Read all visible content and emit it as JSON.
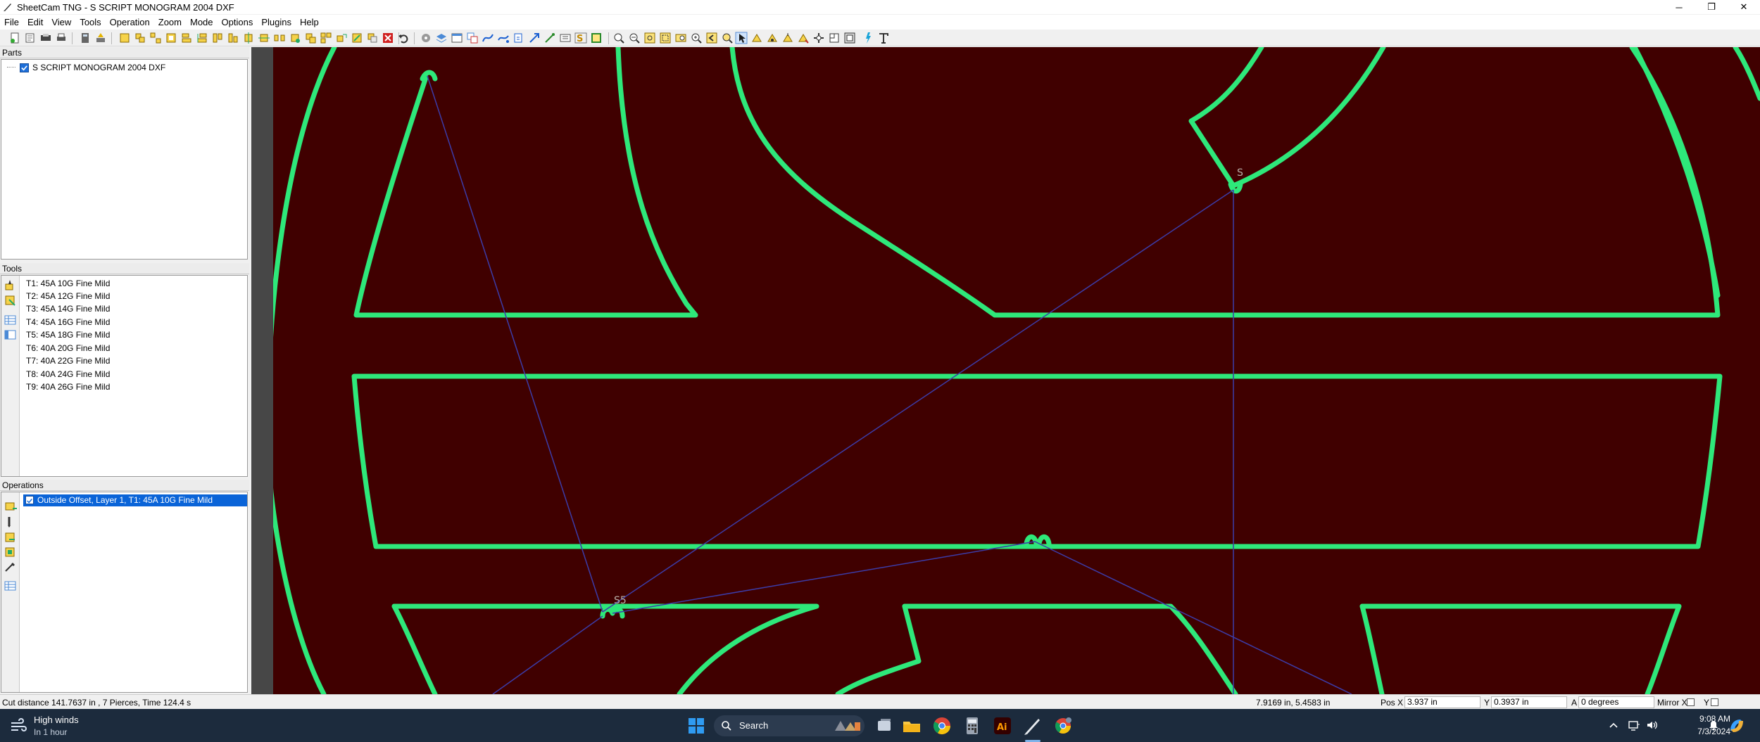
{
  "window": {
    "title": "SheetCam TNG - S SCRIPT MONOGRAM 2004 DXF",
    "controls": {
      "minimize": "─",
      "maximize": "❐",
      "close": "✕"
    }
  },
  "menu": [
    "File",
    "Edit",
    "View",
    "Tools",
    "Operation",
    "Zoom",
    "Mode",
    "Options",
    "Plugins",
    "Help"
  ],
  "parts": {
    "header": "Parts",
    "items": [
      {
        "label": "S SCRIPT MONOGRAM 2004 DXF",
        "checked": true
      }
    ]
  },
  "tools": {
    "header": "Tools",
    "items": [
      "T1: 45A 10G Fine Mild",
      "T2: 45A 12G Fine Mild",
      "T3: 45A 14G Fine Mild",
      "T4: 45A 16G Fine Mild",
      "T5: 45A 18G Fine Mild",
      "T6: 40A 20G Fine Mild",
      "T7: 40A 22G Fine Mild",
      "T8: 40A 24G Fine Mild",
      "T9: 40A 26G Fine Mild"
    ]
  },
  "operations": {
    "header": "Operations",
    "items": [
      {
        "label": "Outside Offset, Layer 1, T1: 45A 10G Fine Mild",
        "checked": true,
        "selected": true
      }
    ]
  },
  "canvas": {
    "labels": {
      "s5": "S5",
      "s_top": "S"
    },
    "colors": {
      "background": "#400000",
      "path": "#2ee87a",
      "rapid": "#3c3ca8"
    }
  },
  "status": {
    "cut_info": "Cut distance 141.7637 in , 7 Pierces, Time 124.4 s",
    "cursor": "7.9169 in, 5.4583 in",
    "pos_x_label": "Pos X",
    "pos_x": "3.937 in",
    "y_label": "Y",
    "pos_y": "0.3937 in",
    "a_label": "A",
    "angle": "0 degrees",
    "mirror_x": "Mirror X",
    "mirror_y": "Y"
  },
  "taskbar": {
    "weather_title": "High winds",
    "weather_sub": "In 1 hour",
    "search": "Search",
    "time": "9:08 AM",
    "date": "7/3/2024"
  }
}
